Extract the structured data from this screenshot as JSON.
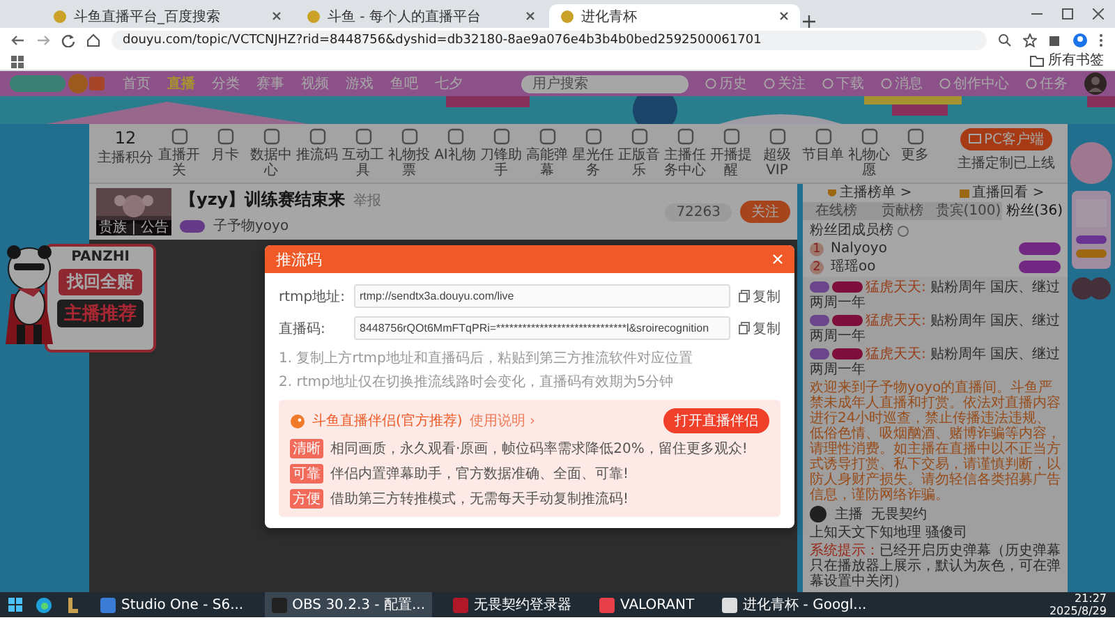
{
  "browser": {
    "tabs": [
      {
        "title": "斗鱼直播平台_百度搜索",
        "selected": false
      },
      {
        "title": "斗鱼 - 每个人的直播平台",
        "selected": false
      },
      {
        "title": "进化青杯",
        "selected": true
      }
    ],
    "url": "douyu.com/topic/VCTCNJHZ?rid=8448756&dyshid=db32180-8ae9a076e4b3b4b0bed2592500061701",
    "bookmarks": "所有书签"
  },
  "nav": {
    "items": [
      {
        "label": "首页",
        "selected": false
      },
      {
        "label": "直播",
        "selected": true
      },
      {
        "label": "分类",
        "selected": false
      },
      {
        "label": "赛事",
        "selected": false
      },
      {
        "label": "视频",
        "selected": false
      },
      {
        "label": "游戏",
        "selected": false
      },
      {
        "label": "鱼吧",
        "selected": false
      },
      {
        "label": "七夕",
        "selected": false
      }
    ],
    "search": {
      "placeholder": "用户搜索"
    },
    "actions": [
      "历史",
      "关注",
      "下载",
      "消息",
      "创作中心",
      "任务"
    ]
  },
  "toolbar": {
    "score": "12",
    "score_label": "主播积分",
    "tools": [
      "直播开关",
      "月卡",
      "数据中心",
      "推流码",
      "互动工具",
      "礼物投票",
      "AI礼物",
      "刀锋助手",
      "高能弹幕",
      "星光任务",
      "正版音乐",
      "主播任务中心",
      "开播提醒",
      "超级VIP",
      "节目单",
      "礼物心愿",
      "更多"
    ],
    "client_button": "PC客户端",
    "client_note": "主播定制已上线"
  },
  "stream": {
    "avatar_caption": "贵族 | 公告",
    "title": "【yzy】训练赛结束来",
    "report": "举报",
    "streamer": "子予物yoyo",
    "followers": "72263",
    "follow_button": "关注"
  },
  "badge": {
    "brand": "PANZHI",
    "line_1": "找回全赔",
    "line_2": "主播推荐"
  },
  "chat": {
    "links": [
      "主播榜单 >",
      "直播回看 >"
    ],
    "tabs": [
      {
        "label": "在线榜",
        "selected": false
      },
      {
        "label": "贡献榜",
        "selected": false
      },
      {
        "label": "贵宾(100)",
        "selected": false
      },
      {
        "label": "粉丝(36)",
        "selected": true
      }
    ],
    "fan_title": "粉丝团成员榜",
    "ranks": [
      {
        "rank": "1",
        "name": "Nalyoyo"
      },
      {
        "rank": "2",
        "name": "瑶瑶oo"
      }
    ],
    "messages": [
      {
        "user": "猛虎天天:",
        "text": "贴粉周年 国庆、继过两周一年"
      },
      {
        "user": "猛虎天天:",
        "text": "贴粉周年 国庆、继过两周一年"
      },
      {
        "user": "猛虎天天:",
        "text": "贴粉周年 国庆、继过两周一年"
      }
    ],
    "notice": "欢迎来到子予物yoyo的直播间。斗鱼严禁未成年人直播和打赏。依法对直播内容进行24小时巡查，禁止传播违法违规、低俗色情、吸烟酗酒、赌博诈骗等内容，请理性消费。如主播在直播中以不正当方式诱导打赏、私下交易，请谨慎判断，以防人身财产损失。请勿轻信各类招募广告信息，谨防网络诈骗。",
    "anchor": {
      "role": "主播",
      "game": "无畏契约",
      "text": "上知天文下知地理 骚傻司"
    },
    "system": {
      "label": "系统提示：",
      "text": "已经开启历史弹幕（历史弹幕只在播放器上展示，默认为灰色，可在弹幕设置中关闭）"
    }
  },
  "modal": {
    "title": "推流码",
    "fields": [
      {
        "label": "rtmp地址:",
        "value": "rtmp://sendtx3a.douyu.com/live",
        "copy": "复制"
      },
      {
        "label": "直播码:",
        "value": "8448756rQOt6MmFTqPRi=******************************l&sroirecognition",
        "copy": "复制"
      }
    ],
    "notes": [
      "1. 复制上方rtmp地址和直播码后，粘贴到第三方推流软件对应位置",
      "2. rtmp地址仅在切换推流线路时会变化，直播码有效期为5分钟"
    ],
    "promo": {
      "title": "斗鱼直播伴侣(官方推荐)",
      "help": "使用说明 ›",
      "button": "打开直播伴侣",
      "features": [
        {
          "tag": "清晰",
          "text": "相同画质，永久观看·原画，帧位码率需求降低20%，留住更多观众!"
        },
        {
          "tag": "可靠",
          "text": "伴侣内置弹幕助手，官方数据准确、全面、可靠!"
        },
        {
          "tag": "方便",
          "text": "借助第三方转推模式，无需每天手动复制推流码!"
        }
      ]
    }
  },
  "taskbar": {
    "apps": [
      {
        "label": "Studio One - S6...",
        "selected": false
      },
      {
        "label": "OBS 30.2.3 - 配置...",
        "selected": true
      },
      {
        "label": "无畏契约登录器",
        "selected": false
      },
      {
        "label": "VALORANT",
        "selected": false
      },
      {
        "label": "进化青杯 - Googl...",
        "selected": false
      }
    ],
    "time": "21:27",
    "date": "2025/8/29"
  }
}
